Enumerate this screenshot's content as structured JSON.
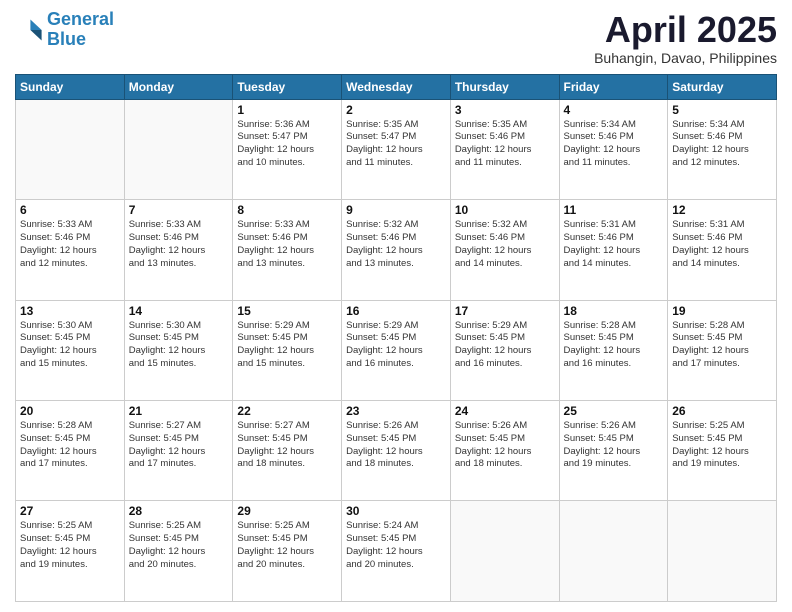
{
  "logo": {
    "line1": "General",
    "line2": "Blue"
  },
  "title": "April 2025",
  "location": "Buhangin, Davao, Philippines",
  "days_of_week": [
    "Sunday",
    "Monday",
    "Tuesday",
    "Wednesday",
    "Thursday",
    "Friday",
    "Saturday"
  ],
  "weeks": [
    [
      {
        "day": "",
        "info": ""
      },
      {
        "day": "",
        "info": ""
      },
      {
        "day": "1",
        "info": "Sunrise: 5:36 AM\nSunset: 5:47 PM\nDaylight: 12 hours\nand 10 minutes."
      },
      {
        "day": "2",
        "info": "Sunrise: 5:35 AM\nSunset: 5:47 PM\nDaylight: 12 hours\nand 11 minutes."
      },
      {
        "day": "3",
        "info": "Sunrise: 5:35 AM\nSunset: 5:46 PM\nDaylight: 12 hours\nand 11 minutes."
      },
      {
        "day": "4",
        "info": "Sunrise: 5:34 AM\nSunset: 5:46 PM\nDaylight: 12 hours\nand 11 minutes."
      },
      {
        "day": "5",
        "info": "Sunrise: 5:34 AM\nSunset: 5:46 PM\nDaylight: 12 hours\nand 12 minutes."
      }
    ],
    [
      {
        "day": "6",
        "info": "Sunrise: 5:33 AM\nSunset: 5:46 PM\nDaylight: 12 hours\nand 12 minutes."
      },
      {
        "day": "7",
        "info": "Sunrise: 5:33 AM\nSunset: 5:46 PM\nDaylight: 12 hours\nand 13 minutes."
      },
      {
        "day": "8",
        "info": "Sunrise: 5:33 AM\nSunset: 5:46 PM\nDaylight: 12 hours\nand 13 minutes."
      },
      {
        "day": "9",
        "info": "Sunrise: 5:32 AM\nSunset: 5:46 PM\nDaylight: 12 hours\nand 13 minutes."
      },
      {
        "day": "10",
        "info": "Sunrise: 5:32 AM\nSunset: 5:46 PM\nDaylight: 12 hours\nand 14 minutes."
      },
      {
        "day": "11",
        "info": "Sunrise: 5:31 AM\nSunset: 5:46 PM\nDaylight: 12 hours\nand 14 minutes."
      },
      {
        "day": "12",
        "info": "Sunrise: 5:31 AM\nSunset: 5:46 PM\nDaylight: 12 hours\nand 14 minutes."
      }
    ],
    [
      {
        "day": "13",
        "info": "Sunrise: 5:30 AM\nSunset: 5:45 PM\nDaylight: 12 hours\nand 15 minutes."
      },
      {
        "day": "14",
        "info": "Sunrise: 5:30 AM\nSunset: 5:45 PM\nDaylight: 12 hours\nand 15 minutes."
      },
      {
        "day": "15",
        "info": "Sunrise: 5:29 AM\nSunset: 5:45 PM\nDaylight: 12 hours\nand 15 minutes."
      },
      {
        "day": "16",
        "info": "Sunrise: 5:29 AM\nSunset: 5:45 PM\nDaylight: 12 hours\nand 16 minutes."
      },
      {
        "day": "17",
        "info": "Sunrise: 5:29 AM\nSunset: 5:45 PM\nDaylight: 12 hours\nand 16 minutes."
      },
      {
        "day": "18",
        "info": "Sunrise: 5:28 AM\nSunset: 5:45 PM\nDaylight: 12 hours\nand 16 minutes."
      },
      {
        "day": "19",
        "info": "Sunrise: 5:28 AM\nSunset: 5:45 PM\nDaylight: 12 hours\nand 17 minutes."
      }
    ],
    [
      {
        "day": "20",
        "info": "Sunrise: 5:28 AM\nSunset: 5:45 PM\nDaylight: 12 hours\nand 17 minutes."
      },
      {
        "day": "21",
        "info": "Sunrise: 5:27 AM\nSunset: 5:45 PM\nDaylight: 12 hours\nand 17 minutes."
      },
      {
        "day": "22",
        "info": "Sunrise: 5:27 AM\nSunset: 5:45 PM\nDaylight: 12 hours\nand 18 minutes."
      },
      {
        "day": "23",
        "info": "Sunrise: 5:26 AM\nSunset: 5:45 PM\nDaylight: 12 hours\nand 18 minutes."
      },
      {
        "day": "24",
        "info": "Sunrise: 5:26 AM\nSunset: 5:45 PM\nDaylight: 12 hours\nand 18 minutes."
      },
      {
        "day": "25",
        "info": "Sunrise: 5:26 AM\nSunset: 5:45 PM\nDaylight: 12 hours\nand 19 minutes."
      },
      {
        "day": "26",
        "info": "Sunrise: 5:25 AM\nSunset: 5:45 PM\nDaylight: 12 hours\nand 19 minutes."
      }
    ],
    [
      {
        "day": "27",
        "info": "Sunrise: 5:25 AM\nSunset: 5:45 PM\nDaylight: 12 hours\nand 19 minutes."
      },
      {
        "day": "28",
        "info": "Sunrise: 5:25 AM\nSunset: 5:45 PM\nDaylight: 12 hours\nand 20 minutes."
      },
      {
        "day": "29",
        "info": "Sunrise: 5:25 AM\nSunset: 5:45 PM\nDaylight: 12 hours\nand 20 minutes."
      },
      {
        "day": "30",
        "info": "Sunrise: 5:24 AM\nSunset: 5:45 PM\nDaylight: 12 hours\nand 20 minutes."
      },
      {
        "day": "",
        "info": ""
      },
      {
        "day": "",
        "info": ""
      },
      {
        "day": "",
        "info": ""
      }
    ]
  ]
}
